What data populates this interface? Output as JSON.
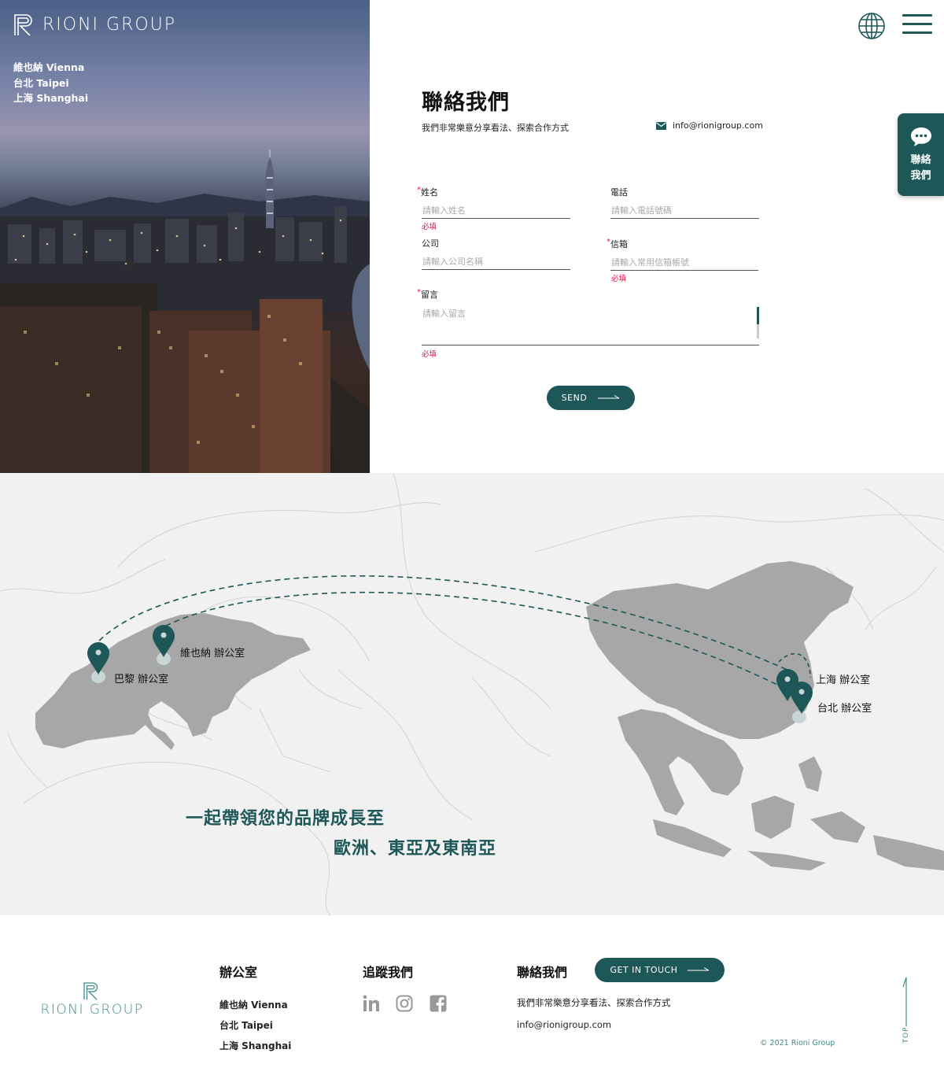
{
  "brand": {
    "name": "RIONI GROUP"
  },
  "hero": {
    "cities": [
      "維也納 Vienna",
      "台北 Taipei",
      "上海 Shanghai"
    ]
  },
  "side_contact": {
    "line1": "聯絡",
    "line2": "我們"
  },
  "contact": {
    "title": "聯絡我們",
    "subtitle": "我們非常樂意分享看法、探索合作方式",
    "email": "info@rionigroup.com",
    "fields": {
      "name": {
        "label": "姓名",
        "required": "*",
        "placeholder": "請輸入姓名",
        "error": "必填"
      },
      "phone": {
        "label": "電話",
        "placeholder": "請輸入電話號碼"
      },
      "company": {
        "label": "公司",
        "placeholder": "請輸入公司名稱"
      },
      "mail": {
        "label": "信箱",
        "required": "*",
        "placeholder": "請輸入常用信箱帳號",
        "error": "必填"
      },
      "message": {
        "label": "留言",
        "required": "*",
        "placeholder": "請輸入留言",
        "error": "必填"
      }
    },
    "send_label": "SEND"
  },
  "map": {
    "offices": {
      "paris": "巴黎 辦公室",
      "vienna": "維也納 辦公室",
      "shanghai": "上海 辦公室",
      "taipei": "台北 辦公室"
    },
    "slogan_line1": "一起帶領您的品牌成長至",
    "slogan_line2": "歐洲、東亞及東南亞",
    "accent_color": "#1d5757"
  },
  "footer": {
    "offices_heading": "辦公室",
    "offices": [
      "維也納 Vienna",
      "台北 Taipei",
      "上海 Shanghai"
    ],
    "follow_heading": "追蹤我們",
    "contact_heading": "聯絡我們",
    "get_in_touch": "GET IN TOUCH",
    "contact_text": "我們非常樂意分享看法、探索合作方式",
    "email": "info@rionigroup.com",
    "copyright": "© 2021 Rioni Group",
    "top_label": "TOP"
  }
}
